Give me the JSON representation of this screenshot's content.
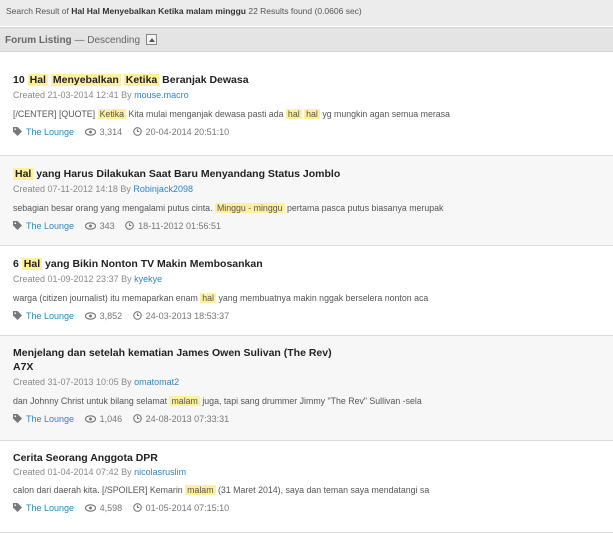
{
  "header": {
    "prefix": "Search Result of ",
    "query": "Hal Hal Menyebalkan Ketika malam minggu",
    "suffix": " 22 Results found (0.0606 sec)"
  },
  "listing": {
    "label": "Forum Listing",
    "sep": " — ",
    "order": "Descending"
  },
  "icons": {
    "tag": "tag-icon",
    "views": "eye-icon",
    "time": "clock-icon"
  },
  "colors": {
    "link": "#2e86c1",
    "highlight": "#fff09a"
  },
  "results": [
    {
      "title": [
        [
          "10 ",
          false
        ],
        [
          "Hal",
          true
        ],
        [
          " ",
          false
        ],
        [
          "Menyebalkan",
          true
        ],
        [
          " ",
          false
        ],
        [
          "Ketika",
          true
        ],
        [
          " Beranjak Dewasa",
          false
        ]
      ],
      "created": "Created 21-03-2014 12:41 By ",
      "author": "mouse.macro",
      "snippet": [
        [
          "[/CENTER] [QUOTE] ",
          false
        ],
        [
          "Ketika",
          true
        ],
        [
          " Kita mulai menganjak dewasa pasti ada ",
          false
        ],
        [
          "hal",
          true
        ],
        [
          " ",
          false
        ],
        [
          "hal",
          true
        ],
        [
          " yg mungkin agan semua merasa",
          false
        ]
      ],
      "forum": "The Lounge",
      "views": "3,314",
      "last": "20-04-2014 20:51:10"
    },
    {
      "title": [
        [
          "Hal",
          true
        ],
        [
          " yang Harus Dilakukan Saat Baru Menyandang Status Jomblo",
          false
        ]
      ],
      "created": "Created 07-11-2012 14:18 By ",
      "author": "Robinjack2098",
      "snippet": [
        [
          "sebagian besar orang yang mengalami putus cinta. ",
          false
        ],
        [
          "Minggu - minggu",
          true
        ],
        [
          " pertama pasca putus biasanya merupak",
          false
        ]
      ],
      "forum": "The Lounge",
      "views": "343",
      "last": "18-11-2012 01:56:51"
    },
    {
      "title": [
        [
          "6 ",
          false
        ],
        [
          "Hal",
          true
        ],
        [
          " yang Bikin Nonton TV Makin Membosankan",
          false
        ]
      ],
      "created": "Created 01-09-2012 23:37 By ",
      "author": "kyekye",
      "snippet": [
        [
          "warga (citizen journalist) itu memaparkan enam ",
          false
        ],
        [
          "hal",
          true
        ],
        [
          " yang membuatnya makin nggak berselera nonton aca",
          false
        ]
      ],
      "forum": "The Lounge",
      "views": "3,852",
      "last": "24-03-2013 18:53:37"
    },
    {
      "title": [
        [
          "Menjelang dan setelah kematian James Owen Sulivan (The Rev)",
          false
        ]
      ],
      "title2": "A7X",
      "created": "Created 31-07-2013 10:05 By ",
      "author": "omatomat2",
      "snippet": [
        [
          "dan Johnny Christ untuk bilang selamat ",
          false
        ],
        [
          "malam",
          true
        ],
        [
          " juga, tapi sang drummer Jimmy \"The Rev\" Sullivan -sela",
          false
        ]
      ],
      "forum": "The Lounge",
      "views": "1,046",
      "last": "24-08-2013 07:33:31"
    },
    {
      "title": [
        [
          "Cerita Seorang Anggota DPR",
          false
        ]
      ],
      "created": "Created 01-04-2014 07:42 By ",
      "author": "nicolasruslim",
      "snippet": [
        [
          "calon dari daerah kita. [/SPOILER] Kemarin ",
          false
        ],
        [
          "malam",
          true
        ],
        [
          " (31 Maret 2014), saya dan teman saya mendatangi sa",
          false
        ]
      ],
      "forum": "The Lounge",
      "views": "4,598",
      "last": "01-05-2014 07:15:10"
    }
  ]
}
